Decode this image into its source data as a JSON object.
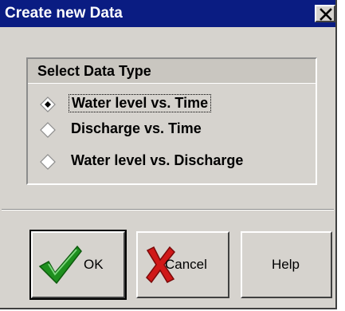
{
  "window": {
    "title": "Create new Data",
    "close_glyph": "X"
  },
  "group": {
    "title": "Select Data Type",
    "options": [
      {
        "label": "Water level vs. Time",
        "selected": true
      },
      {
        "label": "Discharge vs. Time",
        "selected": false
      },
      {
        "label": "Water level vs. Discharge",
        "selected": false
      }
    ]
  },
  "buttons": {
    "ok": {
      "label": "OK",
      "icon": "green-checkmark-icon"
    },
    "cancel": {
      "label": "Cancel",
      "icon": "red-x-icon"
    },
    "help": {
      "label": "Help"
    }
  },
  "colors": {
    "titlebar": "#0a1c82",
    "face": "#d6d3ce",
    "check_green": "#1e8f1e",
    "x_red": "#d01818"
  }
}
